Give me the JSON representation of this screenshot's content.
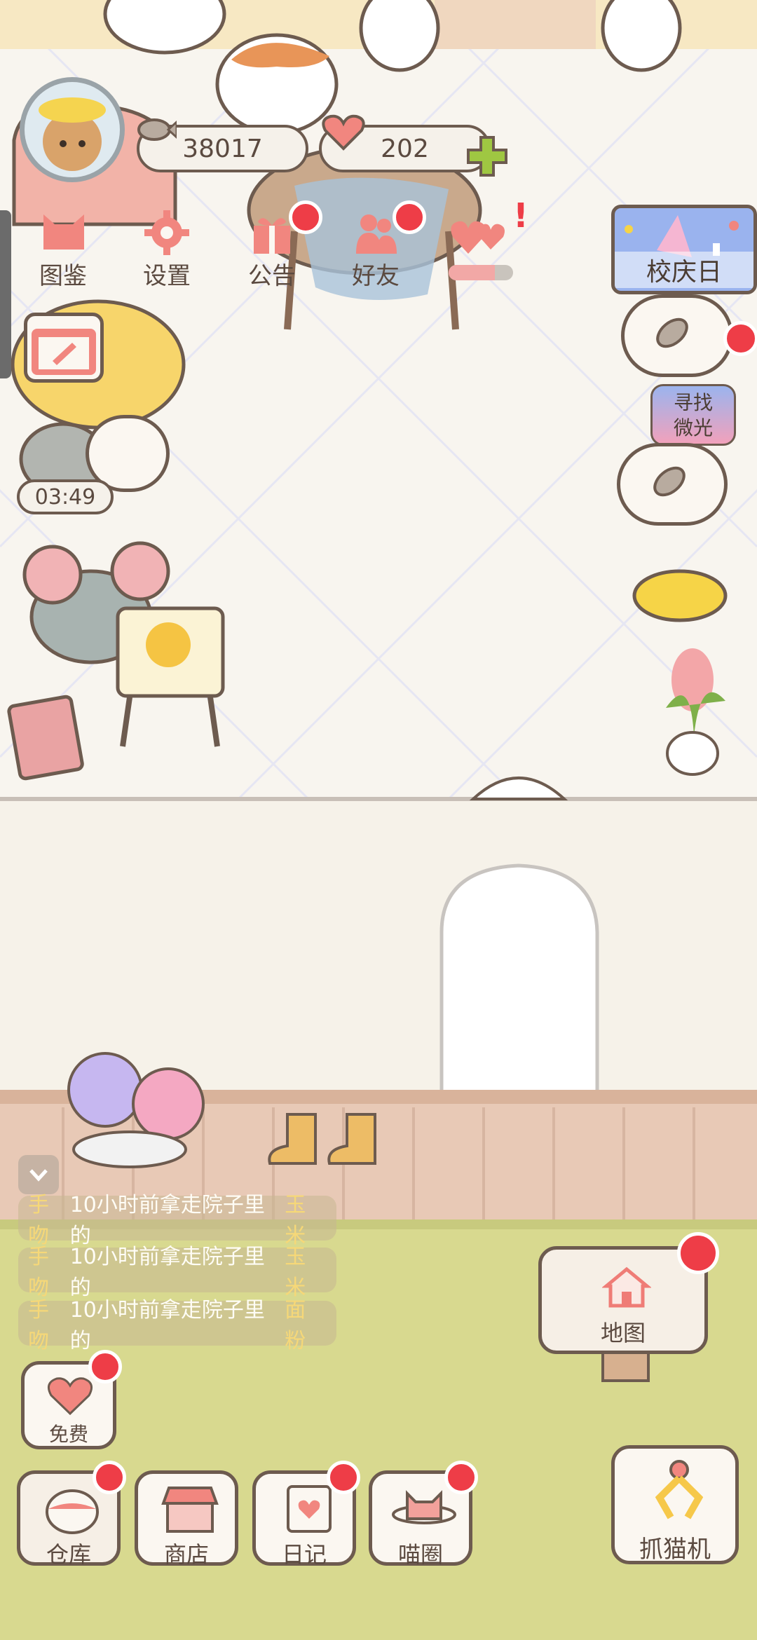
{
  "currency": {
    "fish_count": "38017",
    "heart_count": "202"
  },
  "top_menu": [
    {
      "label": "图鉴",
      "icon": "cat-face-icon",
      "badge": false
    },
    {
      "label": "设置",
      "icon": "gear-icon",
      "badge": false
    },
    {
      "label": "公告",
      "icon": "gift-icon",
      "badge": true
    },
    {
      "label": "好友",
      "icon": "friends-icon",
      "badge": true
    }
  ],
  "event": {
    "label": "校庆日"
  },
  "search": {
    "line1": "寻找",
    "line2": "微光"
  },
  "timer": "03:49",
  "chat_log": [
    {
      "user": "手吻",
      "text": "10小时前拿走院子里的",
      "item": "玉米"
    },
    {
      "user": "手吻",
      "text": "10小时前拿走院子里的",
      "item": "玉米"
    },
    {
      "user": "手吻",
      "text": "10小时前拿走院子里的",
      "item": "面粉"
    }
  ],
  "buttons": {
    "free": "免费",
    "map": "地图",
    "warehouse": "仓库",
    "shop": "商店",
    "diary": "日记",
    "circle": "喵圈",
    "claw": "抓猫机"
  },
  "colors": {
    "accent_red": "#ee3d47",
    "frame_brown": "#6d5b4f",
    "grass": "#d8d98f"
  }
}
